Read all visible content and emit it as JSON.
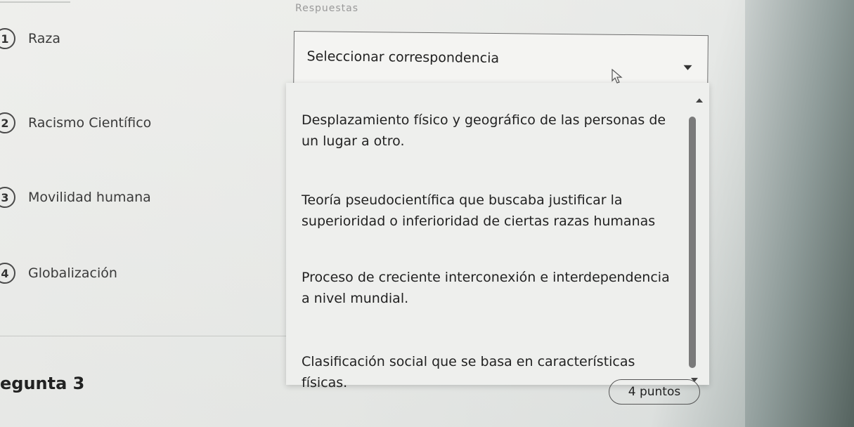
{
  "header": {
    "title_fragment": "Respuestas"
  },
  "items": [
    {
      "number": "1",
      "label": "Raza"
    },
    {
      "number": "2",
      "label": "Racismo Científico"
    },
    {
      "number": "3",
      "label": "Movilidad humana"
    },
    {
      "number": "4",
      "label": "Globalización"
    }
  ],
  "select": {
    "value": "Seleccionar correspondencia",
    "caret_icon": "chevron-down-icon"
  },
  "options": [
    "Desplazamiento físico y geográfico de las personas de un lugar a otro.",
    "Teoría pseudocientífica que buscaba justificar la superioridad o inferioridad de ciertas razas humanas",
    "Proceso de creciente interconexión e interdependencia a nivel mundial.",
    "Clasificación social que se basa en características físicas."
  ],
  "next_question": {
    "heading": "egunta 3",
    "points": "4 puntos"
  },
  "colors": {
    "dropdown_bg": "#eeefed",
    "scrollbar": "#7a7a7a",
    "text": "#222222"
  }
}
